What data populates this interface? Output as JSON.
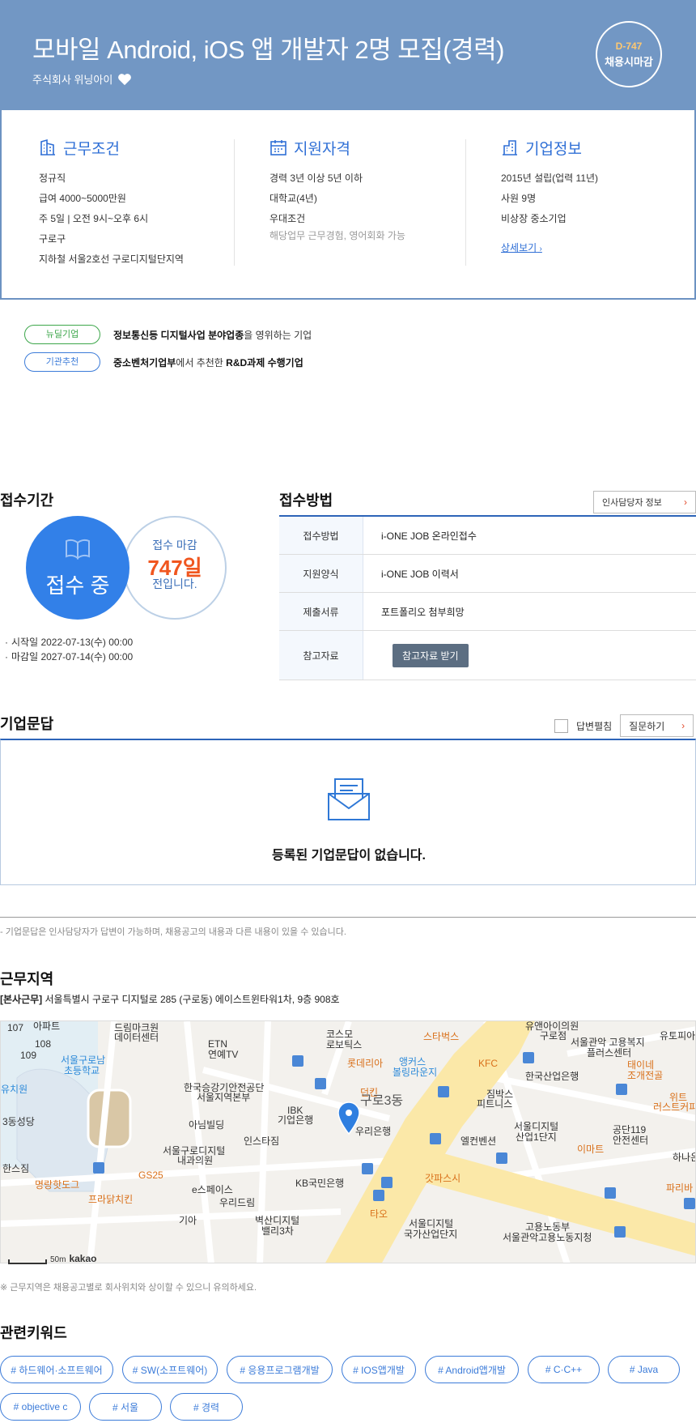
{
  "header": {
    "title": "모바일 Android, iOS 앱 개발자 2명 모집(경력)",
    "company": "주식회사 위닝아이",
    "dday": "D-747",
    "deadline_type": "채용시마감"
  },
  "conditions": {
    "work": {
      "heading": "근무조건",
      "lines": [
        "정규직",
        "급여 4000~5000만원",
        "주 5일 | 오전 9시~오후 6시",
        "구로구",
        "지하철 서울2호선 구로디지털단지역"
      ]
    },
    "qualification": {
      "heading": "지원자격",
      "lines": [
        "경력 3년 이상 5년 이하",
        "대학교(4년)",
        "우대조건"
      ],
      "sub": "해당업무 근무경험, 영어회화 가능"
    },
    "company": {
      "heading": "기업정보",
      "lines": [
        "2015년 설립(업력 11년)",
        "사원 9명",
        "비상장 중소기업"
      ],
      "more": "상세보기"
    }
  },
  "badges": [
    {
      "pill": "뉴딜기업",
      "bold": "정보통신등 디지털사업 분야업종",
      "rest": "을 영위하는 기업"
    },
    {
      "pill": "기관추천",
      "bold": "중소벤처기업부",
      "mid": "에서 추천한 ",
      "bold2": "R&D과제 수행기업"
    }
  ],
  "period": {
    "heading": "접수기간",
    "status": "접수 중",
    "deadline_top": "접수 마감",
    "deadline_days": "747일",
    "deadline_bottom": "전입니다.",
    "start": "시작일 2022-07-13(수) 00:00",
    "end": "마감일 2027-07-14(수) 00:00"
  },
  "method": {
    "heading": "접수방법",
    "hr_button": "인사담당자 정보",
    "rows": [
      {
        "key": "접수방법",
        "value": "i-ONE JOB 온라인접수"
      },
      {
        "key": "지원양식",
        "value": "i-ONE JOB 이력서"
      },
      {
        "key": "제출서류",
        "value": "포트폴리오 첨부희망"
      },
      {
        "key": "참고자료",
        "button": "참고자료 받기"
      }
    ]
  },
  "qa": {
    "heading": "기업문답",
    "check_label": "답변펼침",
    "ask_button": "질문하기",
    "empty": "등록된 기업문답이 없습니다.",
    "note": "- 기업문답은 인사담당자가 답변이 가능하며, 채용공고의 내용과 다른 내용이 있을 수 있습니다."
  },
  "location": {
    "heading": "근무지역",
    "tag": "[본사근무]",
    "address": "서울특별시 구로구 디지털로 285 (구로동) 에이스트윈타워1차, 9층 908호",
    "scale": "50m",
    "provider": "kakao",
    "note": "※ 근무지역은 채용공고별로 회사위치와 상이할 수 있으니 유의하세요.",
    "map_labels": [
      "107",
      "아파트",
      "108",
      "109",
      "드림마크원",
      "데이터센터",
      "ETN",
      "연예TV",
      "코스모",
      "로보틱스",
      "스타벅스",
      "유앤아이의원",
      "구로점",
      "서울관악 고용복지",
      "플러스센터",
      "유토피아",
      "서울구로남",
      "초등학교",
      "유치원",
      "롯데리아",
      "앵커스",
      "볼링라운지",
      "KFC",
      "한국산업은행",
      "태이네",
      "조개전골",
      "한국승강기안전공단",
      "서울지역본부",
      "던킨",
      "IBK",
      "기업은행",
      "구로3동",
      "짐박스",
      "피트니스",
      "위트",
      "러스트커피",
      "3동성당",
      "아님빌딩",
      "우리은행",
      "서울디지털",
      "산업1단지",
      "공단119",
      "안전센터",
      "인스타짐",
      "서울구로디지털",
      "내과의원",
      "엘컨벤션",
      "이마트",
      "하나은",
      "한스짐",
      "GS25",
      "KB국민은행",
      "갓파스시",
      "명랑핫도그",
      "e스페이스",
      "프라닭치킨",
      "파리바",
      "우리드림",
      "기아",
      "벽산디지털",
      "밸리3차",
      "타오",
      "서울디지털",
      "국가산업단지",
      "고용노동부",
      "서울관악고용노동지청"
    ]
  },
  "keywords": {
    "heading": "관련키워드",
    "items": [
      "# 하드웨어·소프트웨어",
      "# SW(소프트웨어)",
      "# 응용프로그램개발",
      "# IOS앱개발",
      "# Android앱개발",
      "# C·C++",
      "# Java",
      "# objective c",
      "# 서울",
      "# 경력"
    ]
  },
  "colors": {
    "header_bg": "#7297c4",
    "accent_blue": "#2f6fd6",
    "status_blue": "#3280e8",
    "days_orange": "#f0561f",
    "dday_yellow": "#ffc870",
    "new_deal_green": "#3ca64a"
  }
}
